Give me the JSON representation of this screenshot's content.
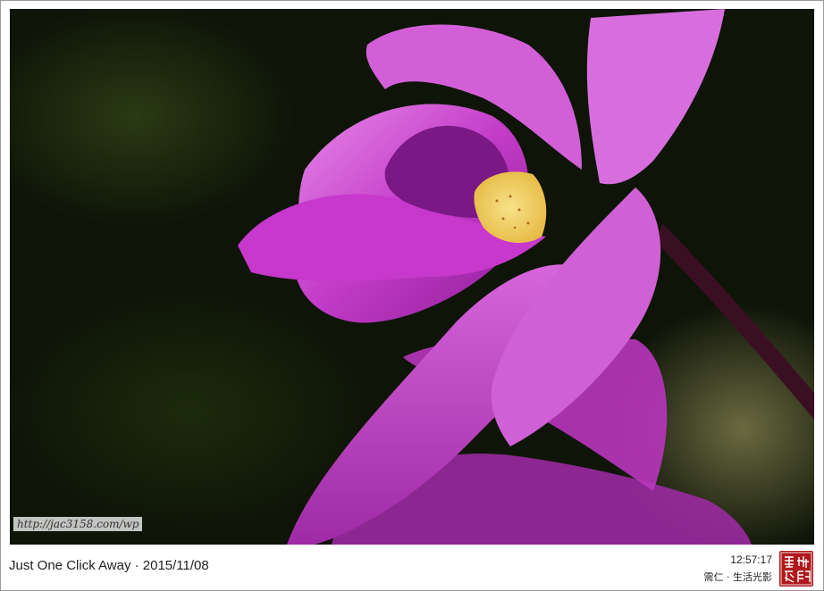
{
  "photo": {
    "subject": "orchid",
    "watermark_url": "http://jac3158.com/wp"
  },
  "footer": {
    "caption": "Just One Click Away · 2015/11/08",
    "time": "12:57:17",
    "byline": "需仁 · 生活光影",
    "seal_text": "需仁遊記"
  },
  "colors": {
    "petal": "#c33cc8",
    "petal_light": "#e47ce8",
    "lip_yellow": "#f2d35a",
    "seal_red": "#b0191e"
  }
}
